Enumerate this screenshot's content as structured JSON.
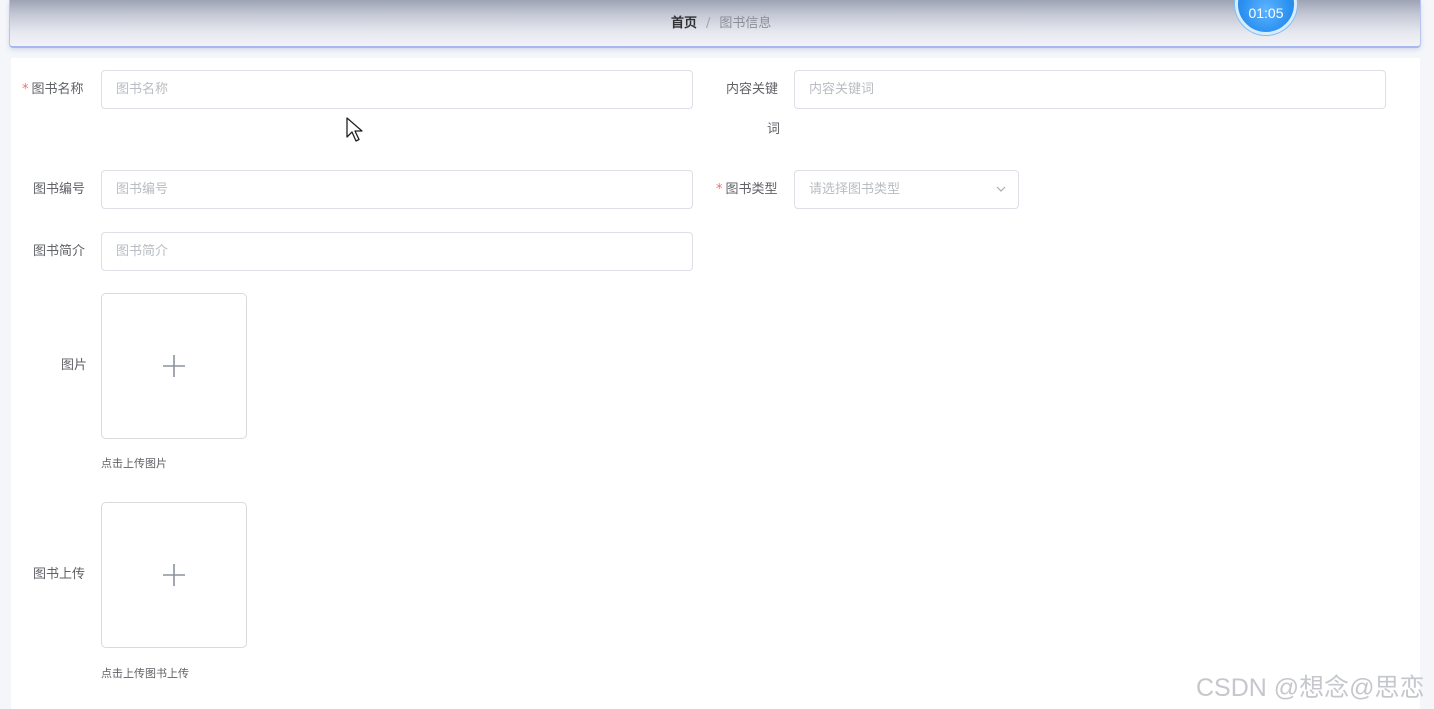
{
  "header": {
    "breadcrumb": {
      "home": "首页",
      "separator": "/",
      "current": "图书信息"
    },
    "timer": "01:05"
  },
  "form": {
    "book_name": {
      "label": "图书名称",
      "required_mark": "*",
      "placeholder": "图书名称",
      "value": ""
    },
    "keywords": {
      "label_line1": "内容关键",
      "label_line2": "词",
      "placeholder": "内容关键词",
      "value": ""
    },
    "book_number": {
      "label": "图书编号",
      "placeholder": "图书编号",
      "value": ""
    },
    "book_type": {
      "label": "图书类型",
      "required_mark": "*",
      "placeholder": "请选择图书类型"
    },
    "book_intro": {
      "label": "图书简介",
      "placeholder": "图书简介",
      "value": ""
    },
    "image": {
      "label": "图片",
      "tip": "点击上传图片"
    },
    "book_upload": {
      "label": "图书上传",
      "tip": "点击上传图书上传"
    }
  },
  "watermark": "CSDN @想念@思恋",
  "icons": {
    "plus": "plus-icon",
    "chevron": "chevron-down-icon",
    "cursor": "mouse-cursor-icon"
  },
  "colors": {
    "required": "#f56c6c",
    "timer": "#2a90f0",
    "header_border": "#a8b8ef"
  }
}
